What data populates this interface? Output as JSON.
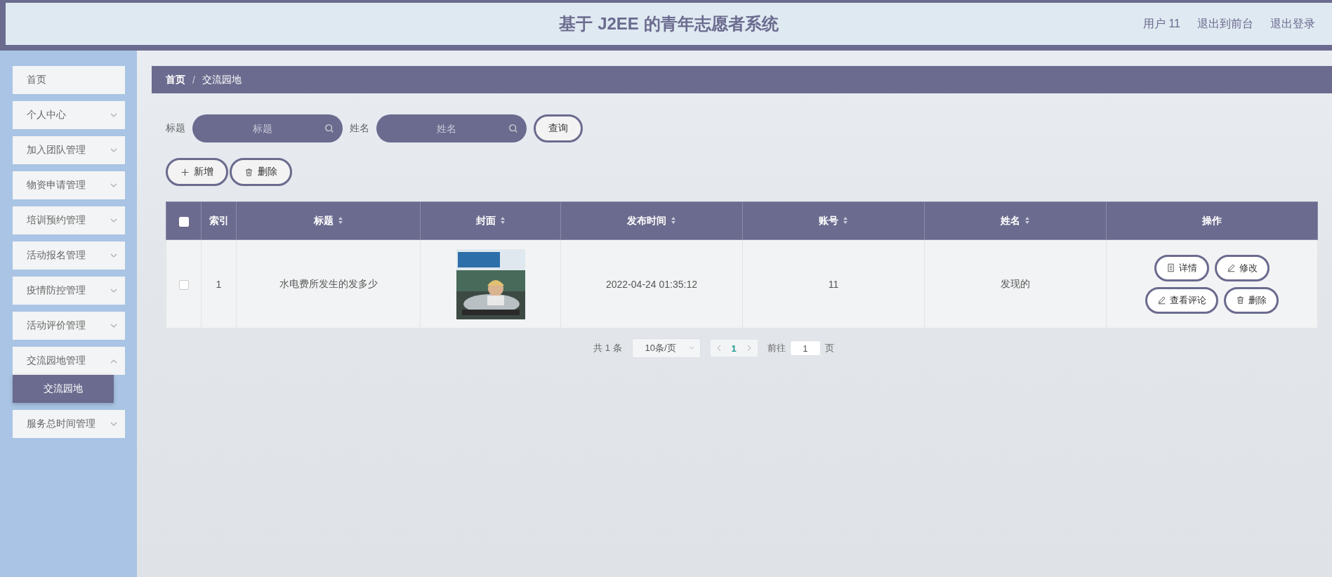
{
  "header": {
    "title": "基于 J2EE 的青年志愿者系统",
    "links": [
      "用户 11",
      "退出到前台",
      "退出登录"
    ]
  },
  "sidebar": {
    "items": [
      {
        "label": "首页",
        "kind": "link",
        "selected": false
      },
      {
        "label": "个人中心",
        "kind": "submenu",
        "expanded": false,
        "selected": false
      },
      {
        "label": "加入团队管理",
        "kind": "submenu",
        "expanded": false,
        "selected": false
      },
      {
        "label": "物资申请管理",
        "kind": "submenu",
        "expanded": false,
        "selected": false
      },
      {
        "label": "培训预约管理",
        "kind": "submenu",
        "expanded": false,
        "selected": false
      },
      {
        "label": "活动报名管理",
        "kind": "submenu",
        "expanded": false,
        "selected": false
      },
      {
        "label": "疫情防控管理",
        "kind": "submenu",
        "expanded": false,
        "selected": false
      },
      {
        "label": "活动评价管理",
        "kind": "submenu",
        "expanded": false,
        "selected": false
      },
      {
        "label": "交流园地管理",
        "kind": "submenu",
        "expanded": true,
        "selected": false,
        "children": [
          {
            "label": "交流园地",
            "selected": true
          }
        ]
      },
      {
        "label": "服务总时间管理",
        "kind": "submenu",
        "expanded": false,
        "selected": false
      }
    ]
  },
  "breadcrumb": [
    "首页",
    "/",
    "交流园地"
  ],
  "search": {
    "fields": [
      {
        "label": "标题",
        "placeholder": "标题"
      },
      {
        "label": "姓名",
        "placeholder": "姓名"
      }
    ],
    "button": "查询"
  },
  "actions": [
    {
      "kind": "add",
      "label": "新增"
    },
    {
      "kind": "delete",
      "label": "删除"
    }
  ],
  "table": {
    "select_all": {
      "checked": false
    },
    "columns": [
      {
        "label": "索引",
        "sortable": false
      },
      {
        "label": "标题",
        "sortable": true
      },
      {
        "label": "封面",
        "sortable": true
      },
      {
        "label": "发布时间",
        "sortable": true
      },
      {
        "label": "账号",
        "sortable": true
      },
      {
        "label": "姓名",
        "sortable": true
      },
      {
        "label": "操作",
        "sortable": false
      }
    ],
    "rows": [
      {
        "checked": false,
        "index": "1",
        "title": "水电费所发生的发多少",
        "published": "2022-04-24 01:35:12",
        "account": "11",
        "name": "发现的",
        "actions": [
          {
            "kind": "detail",
            "label": "详情"
          },
          {
            "kind": "edit",
            "label": "修改"
          },
          {
            "kind": "edit",
            "label": "查看评论"
          },
          {
            "kind": "delete",
            "label": "删除"
          }
        ]
      }
    ]
  },
  "pagination": {
    "total": "共 1 条",
    "page_size": "10条/页",
    "pages": [
      {
        "label": "1",
        "selected": true
      }
    ],
    "goto_label": "前往",
    "goto_value": "1",
    "goto_suffix": "页"
  }
}
